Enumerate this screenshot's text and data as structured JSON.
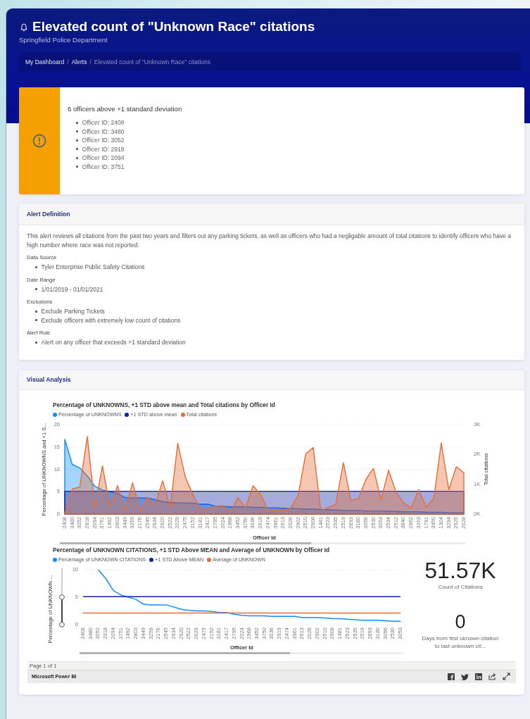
{
  "header": {
    "title": "Elevated count of \"Unknown Race\" citations",
    "subtitle": "Springfield Police Department"
  },
  "breadcrumb": {
    "separator": "/",
    "items": [
      {
        "label": "My Dashboard",
        "current": false
      },
      {
        "label": "Alerts",
        "current": false
      },
      {
        "label": "Elevated count of \"Unknown Race\" citations",
        "current": true
      }
    ]
  },
  "alert": {
    "title": "6 officers above +1 standard deviation",
    "items": [
      "Officer ID: 2408",
      "Officer ID: 3480",
      "Officer ID: 3052",
      "Officer ID: 2918",
      "Officer ID: 2094",
      "Officer ID: 3751"
    ]
  },
  "definition": {
    "heading": "Alert Definition",
    "description": "This alert reviews all citations from the past two years and filters out any parking tickets, as well as officers who had a negligable amount of total citations to identify officers who have a high number where race was not reported.",
    "sections": [
      {
        "label": "Data Source",
        "items": [
          "Tyler Enterprise Public Safety Citations"
        ]
      },
      {
        "label": "Date Range",
        "items": [
          "1/01/2019 - 01/01/2021"
        ]
      },
      {
        "label": "Exclusions",
        "items": [
          "Exclude Parking Tickets",
          "Exclude officers with extremely low count of citations"
        ]
      },
      {
        "label": "Alert Rule",
        "items": [
          "Alert on any officer that exceeds +1 standard deviation"
        ]
      }
    ]
  },
  "visual_analysis": {
    "heading": "Visual Analysis",
    "charts": [
      {
        "chart_data": {
          "type": "area",
          "title": "Percentage of UNKNOWNS, +1 STD above mean and Total citations by Officer Id",
          "xlabel": "Officer Id",
          "ylabel": "Percentage of UNKNOWNS and +1 S...",
          "y2label": "Total citations",
          "ylim": [
            0,
            20
          ],
          "yticks": [
            0,
            5,
            10,
            15,
            20
          ],
          "y2lim": [
            0,
            3000
          ],
          "y2ticks": [
            {
              "value": 0,
              "label": "0K"
            },
            {
              "value": 1000,
              "label": "1K"
            },
            {
              "value": 2000,
              "label": "2K"
            },
            {
              "value": 3000,
              "label": "3K"
            }
          ],
          "stacked": false,
          "legend": true,
          "grid": true,
          "categories": [
            "2408",
            "3480",
            "3052",
            "2918",
            "2094",
            "3751",
            "1492",
            "2803",
            "3449",
            "3259",
            "2176",
            "2545",
            "2934",
            "2920",
            "2522",
            "2029",
            "2475",
            "2152",
            "3181",
            "2417",
            "2795",
            "2024",
            "1968",
            "3452",
            "3750",
            "3036",
            "2919",
            "2474",
            "3961",
            "2913",
            "2026",
            "2902",
            "2510",
            "2908",
            "1481",
            "2523",
            "2535",
            "2519",
            "2693",
            "3180",
            "3056",
            "2530",
            "3053",
            "2534",
            "2512",
            "3840",
            "2962",
            "3203",
            "1791",
            "3450",
            "1304",
            "3294",
            "2925",
            "2028"
          ],
          "series": [
            {
              "name": "Percentage of UNKNOWNS",
              "color": "#118dff",
              "values": [
                16.7,
                11.1,
                10.3,
                8.5,
                6.2,
                5.4,
                5.0,
                4.6,
                3.7,
                3.6,
                3.6,
                3.6,
                3.2,
                2.8,
                2.6,
                2.5,
                2.5,
                2.4,
                2.2,
                2.2,
                1.8,
                1.7,
                1.6,
                1.6,
                1.6,
                1.5,
                1.5,
                1.4,
                1.4,
                1.3,
                1.3,
                1.2,
                1.1,
                1.1,
                1.0,
                1.0,
                0.9,
                0.8,
                0.8,
                0.8,
                0.7,
                0.7,
                0.7,
                0.6,
                0.6,
                0.5,
                0.5,
                0.5,
                0.4,
                0.4,
                0.4,
                0.3,
                0.3,
                0.3
              ]
            },
            {
              "name": "+1 STD above mean",
              "color": "#12239e",
              "values": [
                5.1,
                5.1,
                5.1,
                5.1,
                5.1,
                5.1,
                5.1,
                5.1,
                5.1,
                5.1,
                5.1,
                5.1,
                5.1,
                5.1,
                5.1,
                5.1,
                5.1,
                5.1,
                5.1,
                5.1,
                5.1,
                5.1,
                5.1,
                5.1,
                5.1,
                5.1,
                5.1,
                5.1,
                5.1,
                5.1,
                5.1,
                5.1,
                5.1,
                5.1,
                5.1,
                5.1,
                5.1,
                5.1,
                5.1,
                5.1,
                5.1,
                5.1,
                5.1,
                5.1,
                5.1,
                5.1,
                5.1,
                5.1,
                5.1,
                5.1,
                5.1,
                5.1,
                5.1,
                5.1
              ]
            },
            {
              "name": "Total citations",
              "color": "#e66c37",
              "axis": "y2",
              "values": [
                20,
                840,
                910,
                2600,
                210,
                1620,
                250,
                960,
                120,
                1050,
                100,
                560,
                300,
                1120,
                230,
                2370,
                1250,
                660,
                180,
                140,
                270,
                280,
                60,
                560,
                200,
                950,
                660,
                130,
                130,
                150,
                200,
                620,
                2020,
                2230,
                100,
                220,
                330,
                1730,
                460,
                510,
                1170,
                1530,
                470,
                1470,
                730,
                380,
                200,
                820,
                230,
                520,
                2390,
                820,
                1590,
                1390
              ]
            }
          ]
        }
      },
      {
        "chart_data": {
          "type": "line",
          "title": "Percentage of UNKNOWN CITATIONS, +1 STD Above MEAN and Average of UNKNOWN by Officer Id",
          "xlabel": "Officer Id",
          "ylabel": "Percentage of UNKNOWN ...",
          "ylim": [
            0,
            10
          ],
          "yticks": [
            0,
            5,
            10
          ],
          "legend": true,
          "grid": true,
          "categories": [
            "2408",
            "3480",
            "3052",
            "2918",
            "2094",
            "3751",
            "1492",
            "2803",
            "3449",
            "3259",
            "2176",
            "2545",
            "2934",
            "2920",
            "2522",
            "2029",
            "2475",
            "2152",
            "3181",
            "2417",
            "2795",
            "2024",
            "1968",
            "3452",
            "3750",
            "3036",
            "2919",
            "2474",
            "3961",
            "2913",
            "2026",
            "2902",
            "2510",
            "2908",
            "1481",
            "2523",
            "2535",
            "2519",
            "2693",
            "3180",
            "3056",
            "2530",
            "3053"
          ],
          "series": [
            {
              "name": "Percentage of UNKNOWN CITATIONS",
              "color": "#118dff",
              "values": [
                null,
                null,
                10.0,
                8.4,
                6.2,
                5.4,
                5.0,
                4.6,
                3.7,
                3.6,
                3.6,
                3.6,
                3.2,
                2.8,
                2.6,
                2.5,
                2.5,
                2.4,
                2.2,
                2.2,
                1.9,
                1.7,
                1.6,
                1.6,
                1.6,
                1.5,
                1.5,
                1.5,
                1.5,
                1.3,
                1.3,
                1.3,
                1.2,
                1.1,
                1.1,
                1.0,
                0.9,
                0.8,
                0.8,
                0.8,
                0.7,
                0.6,
                0.6
              ]
            },
            {
              "name": "+1 STD Above MEAN",
              "color": "#12239e",
              "values": [
                5.1,
                5.1,
                5.1,
                5.1,
                5.1,
                5.1,
                5.1,
                5.1,
                5.1,
                5.1,
                5.1,
                5.1,
                5.1,
                5.1,
                5.1,
                5.1,
                5.1,
                5.1,
                5.1,
                5.1,
                5.1,
                5.1,
                5.1,
                5.1,
                5.1,
                5.1,
                5.1,
                5.1,
                5.1,
                5.1,
                5.1,
                5.1,
                5.1,
                5.1,
                5.1,
                5.1,
                5.1,
                5.1,
                5.1,
                5.1,
                5.1,
                5.1,
                5.1
              ]
            },
            {
              "name": "Average of UNKNOWN",
              "color": "#e66c37",
              "values": [
                2.1,
                2.1,
                2.1,
                2.1,
                2.1,
                2.1,
                2.1,
                2.1,
                2.1,
                2.1,
                2.1,
                2.1,
                2.1,
                2.1,
                2.1,
                2.1,
                2.1,
                2.1,
                2.1,
                2.1,
                2.1,
                2.1,
                2.1,
                2.1,
                2.1,
                2.1,
                2.1,
                2.1,
                2.1,
                2.1,
                2.1,
                2.1,
                2.1,
                2.1,
                2.1,
                2.1,
                2.1,
                2.1,
                2.1,
                2.1,
                2.1,
                2.1,
                2.1
              ]
            }
          ]
        }
      }
    ],
    "kpis": [
      {
        "value": "51.57K",
        "label": "Count of Citations"
      },
      {
        "value": "0",
        "label": "Days from first uknown citation to last unknown cit..."
      }
    ],
    "page_indicator": "Page 1 of 1",
    "footer_brand": "Microsoft Power BI"
  }
}
